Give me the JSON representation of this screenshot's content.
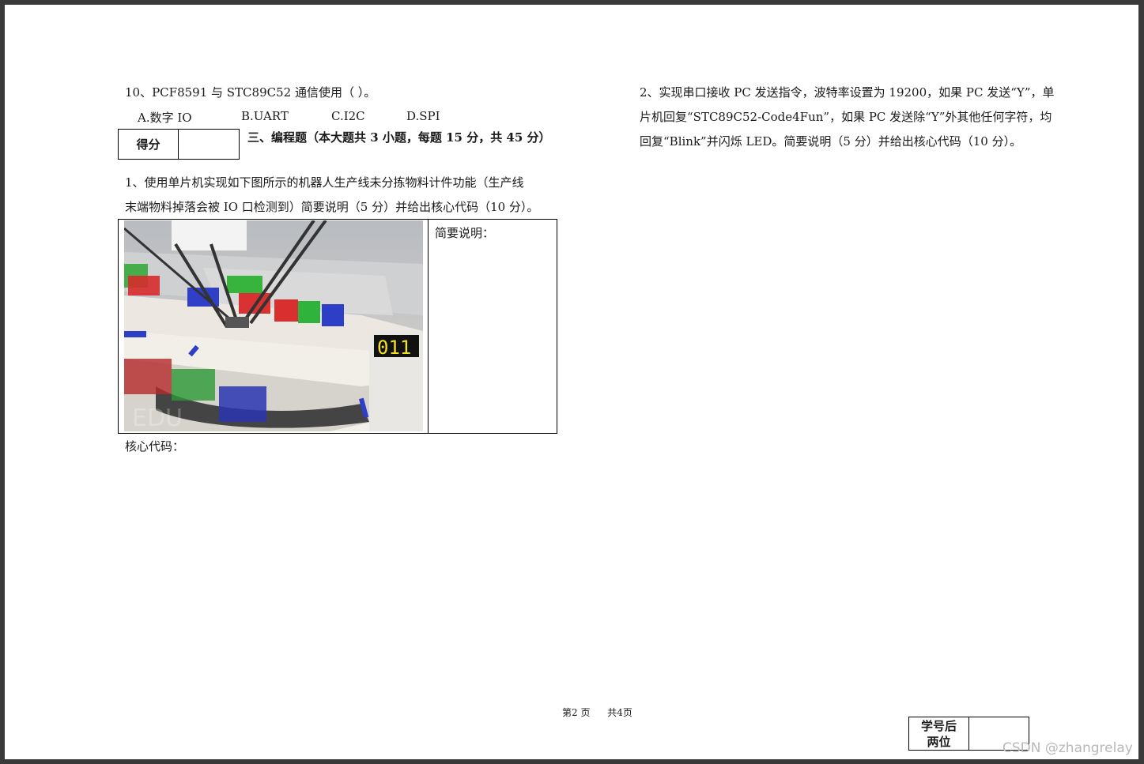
{
  "q10": {
    "text": "10、PCF8591 与 STC89C52 通信使用（            ）。",
    "options": [
      "A.数字 IO",
      "B.UART",
      "C.I2C",
      "D.SPI"
    ]
  },
  "score_label": "得分",
  "section_title": "三、编程题（本大题共 3 小题，每题 15 分，共 45 分）",
  "q1": {
    "line1": "1、使用单片机实现如下图所示的机器人生产线未分拣物料计件功能（生产线",
    "line2": "末端物料掉落会被 IO 口检测到）简要说明（5 分）并给出核心代码（10 分）。",
    "note_label": "简要说明：",
    "core_label": "核心代码：",
    "counter": "011",
    "sim_watermark": "EDU"
  },
  "q2": {
    "line1": "2、实现串口接收 PC 发送指令，波特率设置为 19200，如果 PC 发送“Y”，单",
    "line2": "片机回复“STC89C52-Code4Fun”，如果 PC 发送除“Y”外其他任何字符，均",
    "line3": "回复“Blink”并闪烁 LED。简要说明（5 分）并给出核心代码（10 分）。"
  },
  "footer": {
    "page": "第2 页",
    "total": "共4页"
  },
  "id_box": {
    "line1": "学号后",
    "line2": "两位"
  },
  "watermark": "CSDN @zhangrelay"
}
